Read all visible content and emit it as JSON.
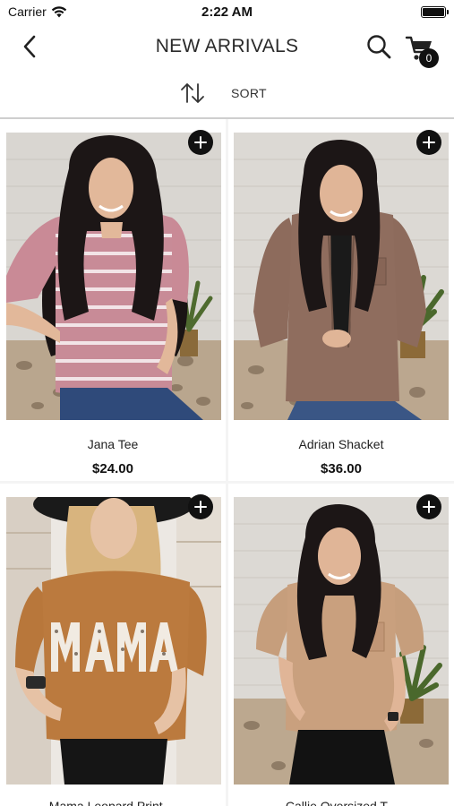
{
  "status_bar": {
    "carrier": "Carrier",
    "time": "2:22 AM",
    "icons": [
      "wifi-icon",
      "battery-icon"
    ]
  },
  "nav": {
    "title": "NEW ARRIVALS",
    "back_icon": "chevron-left-icon",
    "search_icon": "search-icon",
    "cart_icon": "cart-icon",
    "cart_count": "0"
  },
  "sort": {
    "label": "SORT",
    "icon": "sort-arrows-icon"
  },
  "products": [
    {
      "name": "Jana Tee",
      "price": "$24.00",
      "add_icon": "plus-icon"
    },
    {
      "name": "Adrian Shacket",
      "price": "$36.00",
      "add_icon": "plus-icon"
    },
    {
      "name": "Mama Leopard Print ...",
      "price": "",
      "add_icon": "plus-icon"
    },
    {
      "name": "Callie Oversized T...",
      "price": "",
      "add_icon": "plus-icon"
    }
  ],
  "colors": {
    "accent": "#111111",
    "divider": "#cfcfcf",
    "card_bg": "#ffffff",
    "grid_bg": "#f4f4f4"
  }
}
